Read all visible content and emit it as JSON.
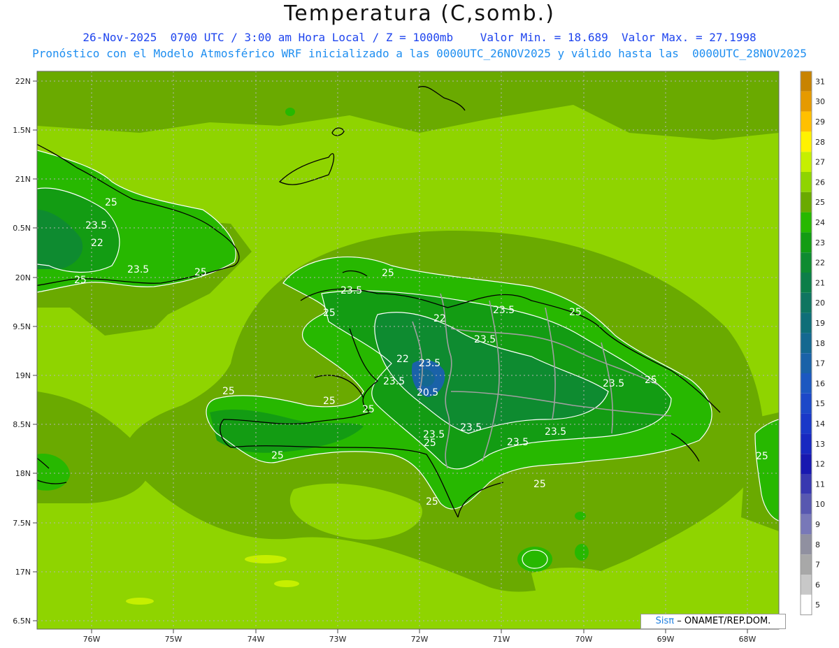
{
  "header": {
    "title": "Temperatura (C,somb.)",
    "subtitle1": "26-Nov-2025  0700 UTC / 3:00 am Hora Local / Z = 1000mb    Valor Min. = 18.689  Valor Max. = 27.1998",
    "subtitle2": "Pronóstico con el Modelo Atmosférico WRF inicializado a las 0000UTC_26NOV2025 y válido hasta las  0000UTC_28NOV2025"
  },
  "axes": {
    "lat_labels": [
      "22N",
      "1.5N",
      "21N",
      "0.5N",
      "20N",
      "9.5N",
      "19N",
      "8.5N",
      "18N",
      "7.5N",
      "17N",
      "6.5N"
    ],
    "lon_labels": [
      "76W",
      "75W",
      "74W",
      "73W",
      "72W",
      "71W",
      "70W",
      "69W",
      "68W"
    ]
  },
  "colorbar": {
    "levels": [
      "31",
      "30",
      "29",
      "28",
      "27",
      "26",
      "25",
      "24",
      "23",
      "22",
      "21",
      "20",
      "19",
      "18",
      "17",
      "16",
      "15",
      "14",
      "13",
      "12",
      "11",
      "10",
      "9",
      "8",
      "7",
      "6",
      "5"
    ],
    "colors": [
      "#c88300",
      "#e59a00",
      "#ffc000",
      "#fff200",
      "#c6ef00",
      "#8fd400",
      "#6aaa00",
      "#27b800",
      "#139c13",
      "#0e8b30",
      "#0c7e48",
      "#0f7560",
      "#0f6e78",
      "#146890",
      "#1a62a8",
      "#1c58c0",
      "#1c48c8",
      "#1a38c8",
      "#1828c0",
      "#1818b0",
      "#3838b0",
      "#5858b0",
      "#7878b8",
      "#9090a0",
      "#a8a8a8",
      "#c8c8c8",
      "#ffffff"
    ]
  },
  "contour_labels": [
    "25",
    "23.5",
    "22",
    "23.5",
    "25",
    "25",
    "25",
    "23.5",
    "25",
    "22",
    "23.5",
    "25",
    "22",
    "23.5",
    "20.5",
    "23.5",
    "25",
    "23.5",
    "25",
    "23.5",
    "25",
    "25",
    "25",
    "23.5",
    "23.5",
    "23.5",
    "23.5",
    "25",
    "25",
    "25",
    "25"
  ],
  "credit": {
    "brand": "Sisπ",
    "text": "– ONAMET/REP.DOM."
  },
  "style": {
    "ocean_light": "#8fd400",
    "ocean_dark": "#6aaa00",
    "land_24": "#27b800",
    "land_23": "#139c13",
    "land_22": "#0e8b30"
  }
}
